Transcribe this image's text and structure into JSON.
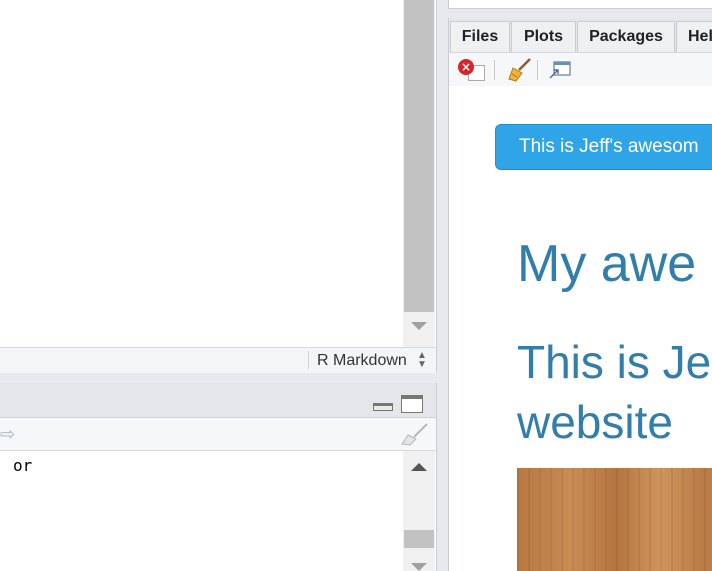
{
  "editor": {
    "doc_type": "R Markdown",
    "doc_type_arrows": "▴▾"
  },
  "console": {
    "output_text": "or",
    "redo_glyph": "⇨"
  },
  "viewer": {
    "tabs": [
      {
        "label": "Files"
      },
      {
        "label": "Plots"
      },
      {
        "label": "Packages"
      },
      {
        "label": "Hel"
      }
    ],
    "remove_glyph": "×",
    "icons": [
      "remove-viewer-icon",
      "clear-viewer-broom-icon",
      "show-in-new-window-icon"
    ]
  },
  "site": {
    "navbar_text": "This is Jeff's awesom",
    "title": "My awe",
    "subtitle": "This is Je website",
    "image_alt": "wood texture"
  },
  "colors": {
    "navbar_bg": "#2fa4e7",
    "heading": "#317eac",
    "chrome": "#e4e6e9"
  }
}
